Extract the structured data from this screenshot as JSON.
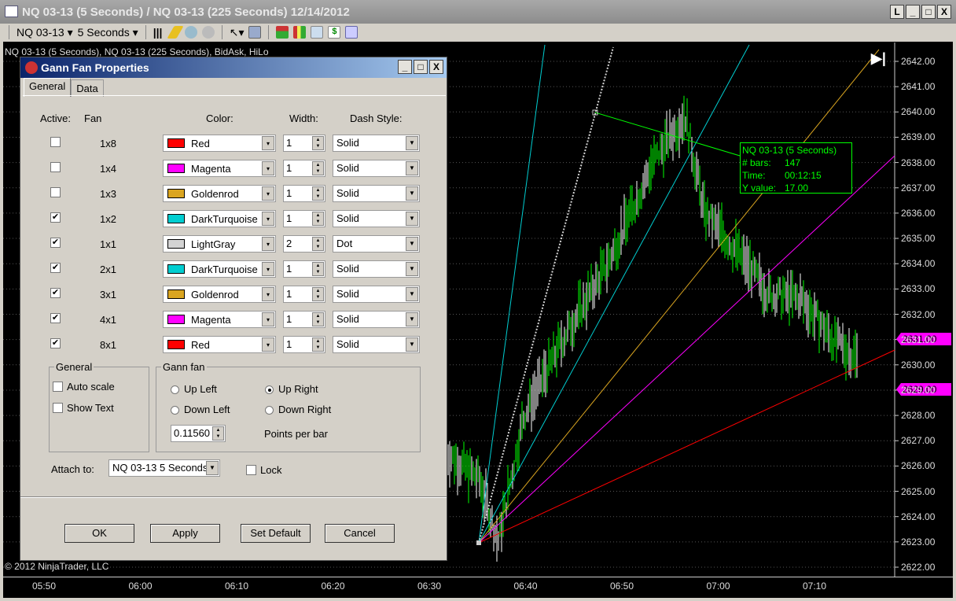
{
  "window": {
    "title": "NQ 03-13 (5 Seconds) / NQ 03-13 (225 Seconds)  12/14/2012",
    "buttons": [
      "L",
      "_",
      "□",
      "X"
    ]
  },
  "toolbar": {
    "instrument": "NQ 03-13",
    "interval": "5 Seconds",
    "icons": [
      "bar-type-icon",
      "pencil-icon",
      "zoom-in-icon",
      "zoom-out-icon",
      "cursor-icon",
      "search-icon",
      "strategy-icon",
      "candles-icon",
      "chart-icon",
      "dollar-icon",
      "data-box-icon"
    ]
  },
  "chart": {
    "caption": "NQ 03-13 (5 Seconds), NQ 03-13 (225 Seconds), BidAsk, HiLo",
    "copyright": "© 2012 NinjaTrader, LLC",
    "y_ticks": [
      "2642.00",
      "2641.00",
      "2640.00",
      "2639.00",
      "2638.00",
      "2637.00",
      "2636.00",
      "2635.00",
      "2634.00",
      "2633.00",
      "2632.00",
      "2631.00",
      "2630.00",
      "2629.00",
      "2628.00",
      "2627.00",
      "2626.00",
      "2625.00",
      "2624.00",
      "2623.00",
      "2622.00"
    ],
    "x_ticks": [
      "05:50",
      "06:00",
      "06:10",
      "06:20",
      "06:30",
      "06:40",
      "06:50",
      "07:00",
      "07:10"
    ],
    "price_tags": [
      {
        "value": "2631.00",
        "color": "#ff00ff"
      },
      {
        "value": "2629.00",
        "color": "#ff00ff"
      }
    ],
    "info": {
      "title": "NQ 03-13 (5 Seconds)",
      "bars_label": "# bars:",
      "bars": "147",
      "time_label": "Time:",
      "time": "00:12:15",
      "y_label": "Y value:",
      "y": "17.00"
    },
    "price_path": [
      [
        0,
        2626.5
      ],
      [
        5,
        2625.5
      ],
      [
        8,
        2623.0
      ],
      [
        12,
        2628
      ],
      [
        18,
        2631
      ],
      [
        25,
        2634
      ],
      [
        32,
        2638
      ],
      [
        37,
        2639.9
      ],
      [
        40,
        2636
      ],
      [
        45,
        2634.5
      ],
      [
        50,
        2632.8
      ],
      [
        55,
        2632.6
      ],
      [
        60,
        2631
      ],
      [
        65,
        2630
      ],
      [
        70,
        2630.4
      ],
      [
        75,
        2629.8
      ],
      [
        82,
        2632
      ],
      [
        88,
        2633.2
      ],
      [
        95,
        2633.5
      ],
      [
        100,
        2631
      ],
      [
        105,
        2629.6
      ],
      [
        110,
        2629.5
      ],
      [
        115,
        2628
      ],
      [
        120,
        2626.7
      ],
      [
        124,
        2628
      ],
      [
        128,
        2632.5
      ]
    ]
  },
  "dialog": {
    "title": "Gann Fan Properties",
    "tabs": [
      "General",
      "Data"
    ],
    "headers": {
      "active": "Active:",
      "fan": "Fan",
      "color": "Color:",
      "width": "Width:",
      "dash": "Dash Style:"
    },
    "fans": [
      {
        "fan": "1x8",
        "active": false,
        "color": "Red",
        "hex": "#ff0000",
        "width": "1",
        "dash": "Solid"
      },
      {
        "fan": "1x4",
        "active": false,
        "color": "Magenta",
        "hex": "#ff00ff",
        "width": "1",
        "dash": "Solid"
      },
      {
        "fan": "1x3",
        "active": false,
        "color": "Goldenrod",
        "hex": "#daa520",
        "width": "1",
        "dash": "Solid"
      },
      {
        "fan": "1x2",
        "active": true,
        "color": "DarkTurquoise",
        "hex": "#00ced1",
        "width": "1",
        "dash": "Solid"
      },
      {
        "fan": "1x1",
        "active": true,
        "color": "LightGray",
        "hex": "#d3d3d3",
        "width": "2",
        "dash": "Dot"
      },
      {
        "fan": "2x1",
        "active": true,
        "color": "DarkTurquoise",
        "hex": "#00ced1",
        "width": "1",
        "dash": "Solid"
      },
      {
        "fan": "3x1",
        "active": true,
        "color": "Goldenrod",
        "hex": "#daa520",
        "width": "1",
        "dash": "Solid"
      },
      {
        "fan": "4x1",
        "active": true,
        "color": "Magenta",
        "hex": "#ff00ff",
        "width": "1",
        "dash": "Solid"
      },
      {
        "fan": "8x1",
        "active": true,
        "color": "Red",
        "hex": "#ff0000",
        "width": "1",
        "dash": "Solid"
      }
    ],
    "general_group": {
      "title": "General",
      "auto_scale": "Auto scale",
      "show_text": "Show Text"
    },
    "gann_group": {
      "title": "Gann fan",
      "up_left": "Up Left",
      "up_right": "Up Right",
      "down_left": "Down Left",
      "down_right": "Down Right",
      "selected": "Up Right",
      "points_per_bar": "0.11560",
      "points_label": "Points per bar"
    },
    "attach_label": "Attach to:",
    "attach_value": "NQ 03-13 5 Seconds",
    "lock": "Lock",
    "buttons": {
      "ok": "OK",
      "apply": "Apply",
      "set_default": "Set Default",
      "cancel": "Cancel"
    }
  }
}
